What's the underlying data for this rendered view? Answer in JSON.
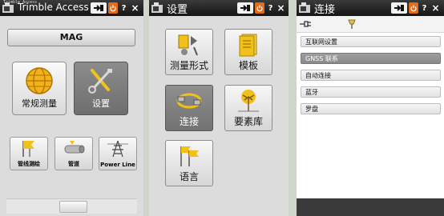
{
  "panel_main": {
    "title_small": "Trimble Access",
    "title": "Trimble Access",
    "mode_button": "MAG",
    "tiles_big": [
      {
        "label": "常规测量",
        "icon": "globe-icon"
      },
      {
        "label": "设置",
        "icon": "tools-icon"
      }
    ],
    "tiles_small": [
      {
        "label": "管线测绘",
        "icon": "flags-icon"
      },
      {
        "label": "管道",
        "icon": "pipe-icon"
      },
      {
        "label": "Power Line",
        "icon": "power-tower-icon"
      }
    ],
    "help_label": "?",
    "close_label": "×"
  },
  "panel_settings": {
    "title": "设置",
    "tiles": [
      {
        "label": "测量形式",
        "icon": "survey-style-icon"
      },
      {
        "label": "模板",
        "icon": "template-icon"
      },
      {
        "label": "连接",
        "icon": "connection-icon"
      },
      {
        "label": "要素库",
        "icon": "feature-library-icon"
      },
      {
        "label": "语言",
        "icon": "language-flags-icon"
      }
    ],
    "help_label": "?",
    "close_label": "×"
  },
  "panel_connect": {
    "title": "连接",
    "items": [
      {
        "label": "互联网设置",
        "selected": false
      },
      {
        "label": "GNSS 联系",
        "selected": true
      },
      {
        "label": "自动连接",
        "selected": false
      },
      {
        "label": "蓝牙",
        "selected": false
      },
      {
        "label": "罗盘",
        "selected": false
      }
    ],
    "help_label": "?",
    "close_label": "×"
  },
  "colors": {
    "titlebar": "#1e1e1e",
    "orange_button": "#e36b1b",
    "tile_selected": "#7d7d7d"
  }
}
